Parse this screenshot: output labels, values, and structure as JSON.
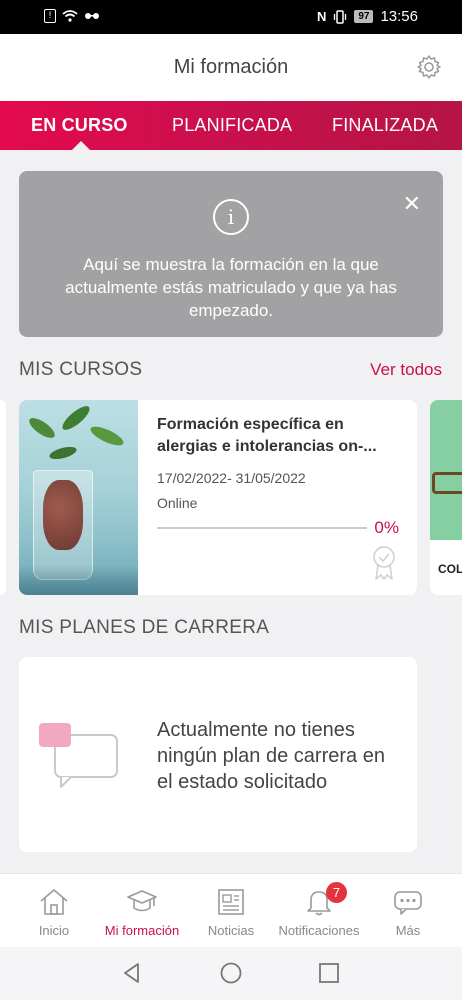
{
  "status_bar": {
    "time": "13:56",
    "battery": "97"
  },
  "header": {
    "title": "Mi formación"
  },
  "tabs": [
    {
      "label": "EN CURSO",
      "active": true
    },
    {
      "label": "PLANIFICADA",
      "active": false
    },
    {
      "label": "FINALIZADA",
      "active": false
    }
  ],
  "info_banner": {
    "text": "Aquí se muestra la formación en la que actualmente estás matriculado y que ya has empezado."
  },
  "courses_section": {
    "title": "MIS CURSOS",
    "see_all": "Ver todos",
    "courses": [
      {
        "title": "Formación específica en alergias e intolerancias on-...",
        "dates": "17/02/2022- 31/05/2022",
        "mode": "Online",
        "progress": 0,
        "progress_label": "0%"
      }
    ],
    "next_peek_label": "COL"
  },
  "career_section": {
    "title": "MIS PLANES DE CARRERA",
    "empty_text": "Actualmente no tienes ningún plan de carrera en el estado solicitado"
  },
  "bottom_nav": [
    {
      "label": "Inicio",
      "icon": "home-icon",
      "active": false
    },
    {
      "label": "Mi formación",
      "icon": "graduation-cap-icon",
      "active": true
    },
    {
      "label": "Noticias",
      "icon": "newspaper-icon",
      "active": false
    },
    {
      "label": "Notificaciones",
      "icon": "bell-icon",
      "active": false,
      "badge": "7"
    },
    {
      "label": "Más",
      "icon": "more-chat-icon",
      "active": false
    }
  ],
  "colors": {
    "accent": "#c8104d",
    "tab_gradient_start": "#e5094f",
    "banner_bg": "#a2a2a4",
    "badge": "#e5333e"
  }
}
